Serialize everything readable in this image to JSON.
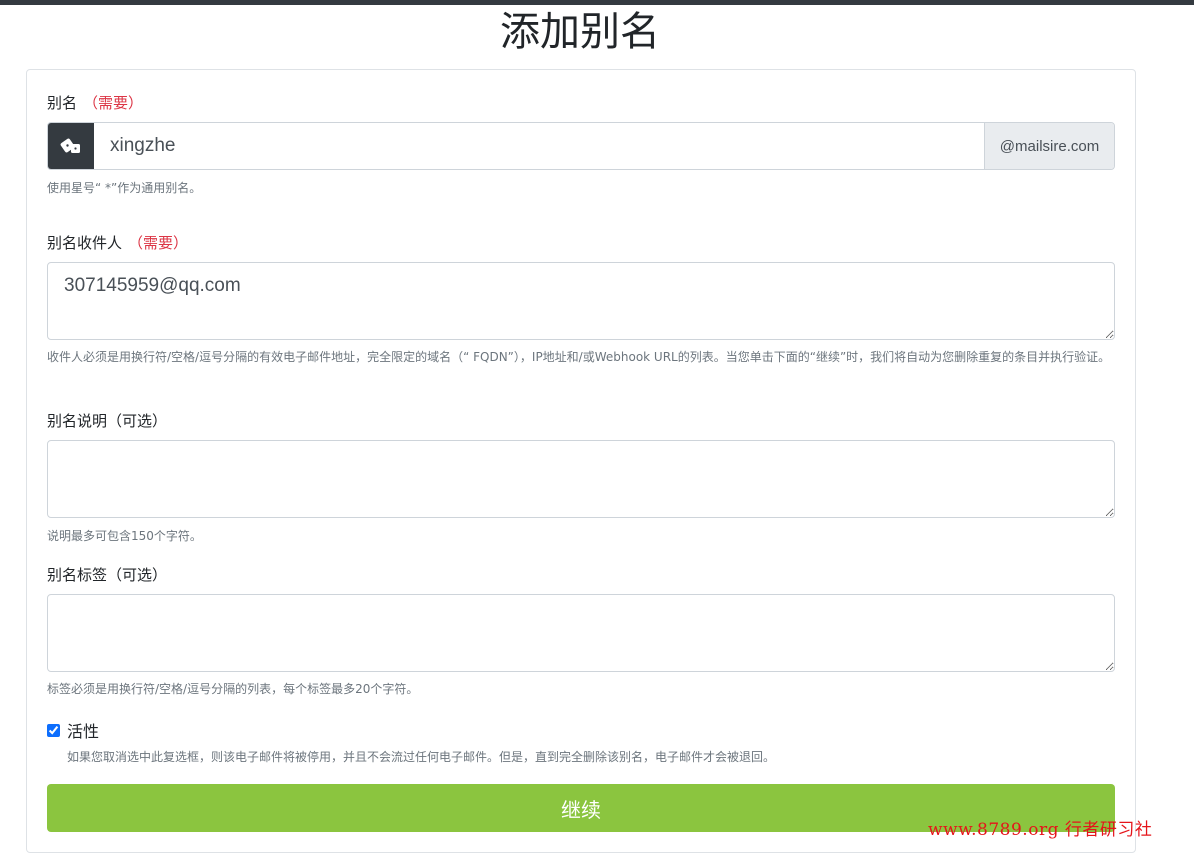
{
  "page": {
    "title": "添加别名"
  },
  "alias": {
    "label": "别名",
    "required": "（需要）",
    "value": "xingzhe",
    "domain": "@mailsire.com",
    "help": "使用星号“ *”作为通用别名。",
    "icon": "dice-icon"
  },
  "recipients": {
    "label": "别名收件人",
    "required": "（需要）",
    "value": "307145959@qq.com",
    "help": "收件人必须是用换行符/空格/逗号分隔的有效电子邮件地址，完全限定的域名（“ FQDN”），IP地址和/或Webhook URL的列表。当您单击下面的“继续”时，我们将自动为您删除重复的条目并执行验证。"
  },
  "description": {
    "label": "别名说明（可选）",
    "value": "",
    "help": "说明最多可包含150个字符。"
  },
  "tags": {
    "label": "别名标签（可选）",
    "value": "",
    "help": "标签必须是用换行符/空格/逗号分隔的列表，每个标签最多20个字符。"
  },
  "active": {
    "label": "活性",
    "checked": true,
    "help": "如果您取消选中此复选框，则该电子邮件将被停用，并且不会流过任何电子邮件。但是，直到完全删除该别名，电子邮件才会被退回。"
  },
  "submit": {
    "label": "继续",
    "color": "#8bc53f"
  },
  "watermark": {
    "text": "www.8789.org 行者研习社"
  }
}
